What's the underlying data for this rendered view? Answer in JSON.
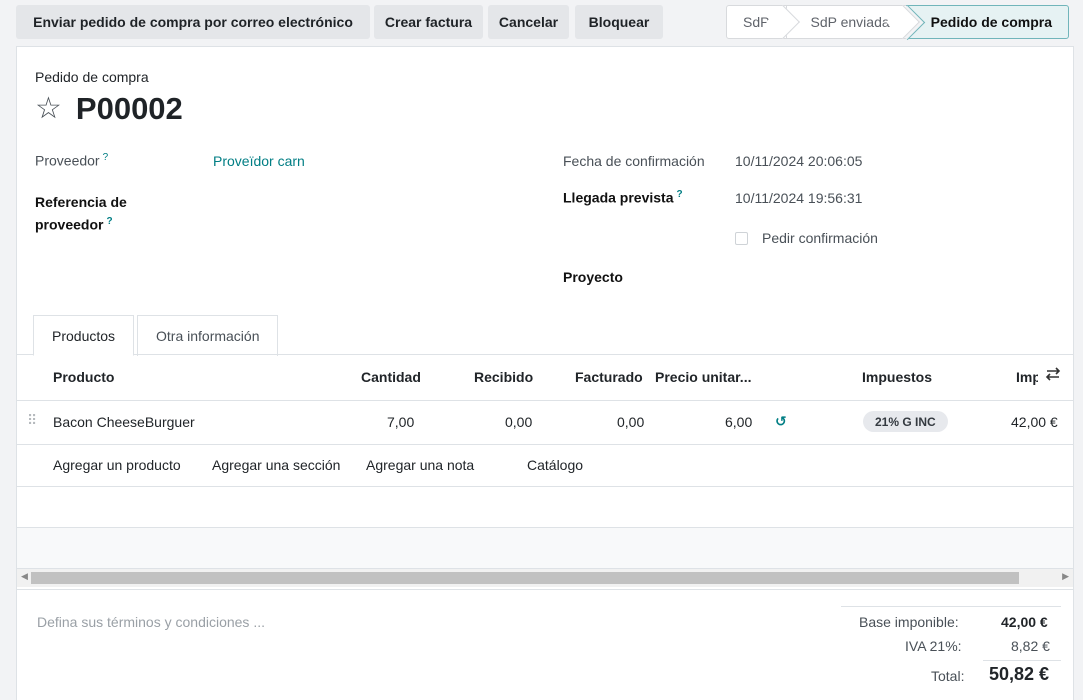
{
  "actions": {
    "send_email": "Enviar pedido de compra por correo electrónico",
    "create_invoice": "Crear factura",
    "cancel": "Cancelar",
    "lock": "Bloquear"
  },
  "status": {
    "steps": [
      "SdP",
      "SdP enviada",
      "Pedido de compra"
    ],
    "active": "Pedido de compra"
  },
  "header": {
    "subtitle": "Pedido de compra",
    "name": "P00002"
  },
  "fields": {
    "vendor_label": "Proveedor",
    "vendor_value": "Proveïdor carn",
    "vendor_ref_label_1": "Referencia de",
    "vendor_ref_label_2": "proveedor",
    "confirm_date_label": "Fecha de confirmación",
    "confirm_date_value": "10/11/2024 20:06:05",
    "expected_label": "Llegada prevista",
    "expected_value": "10/11/2024 19:56:31",
    "ask_confirm_label": "Pedir confirmación",
    "project_label": "Proyecto",
    "help_mark": "?"
  },
  "tabs": [
    "Productos",
    "Otra información"
  ],
  "table": {
    "columns": [
      "Producto",
      "Cantidad",
      "Recibido",
      "Facturado",
      "Precio unitar...",
      "Impuestos",
      "Imp"
    ],
    "rows": [
      {
        "product": "Bacon CheeseBurguer",
        "qty": "7,00",
        "received": "0,00",
        "billed": "0,00",
        "price": "6,00",
        "tax": "21% G INC",
        "amount": "42,00 €"
      }
    ],
    "add_product": "Agregar un producto",
    "add_section": "Agregar una sección",
    "add_note": "Agregar una nota",
    "catalog": "Catálogo"
  },
  "footer": {
    "terms_placeholder": "Defina sus términos y condiciones ...",
    "base_label": "Base imponible:",
    "base_value": "42,00 €",
    "vat_label": "IVA 21%:",
    "vat_value": "8,82 €",
    "total_label": "Total:",
    "total_value": "50,82 €"
  },
  "colors": {
    "accent": "#017e84",
    "active_step": "#e6f2f3"
  },
  "icons": [
    "star-icon",
    "drag-handle-icon",
    "history-icon",
    "column-settings-icon",
    "scroll-left-icon",
    "scroll-right-icon",
    "checkbox-icon"
  ]
}
